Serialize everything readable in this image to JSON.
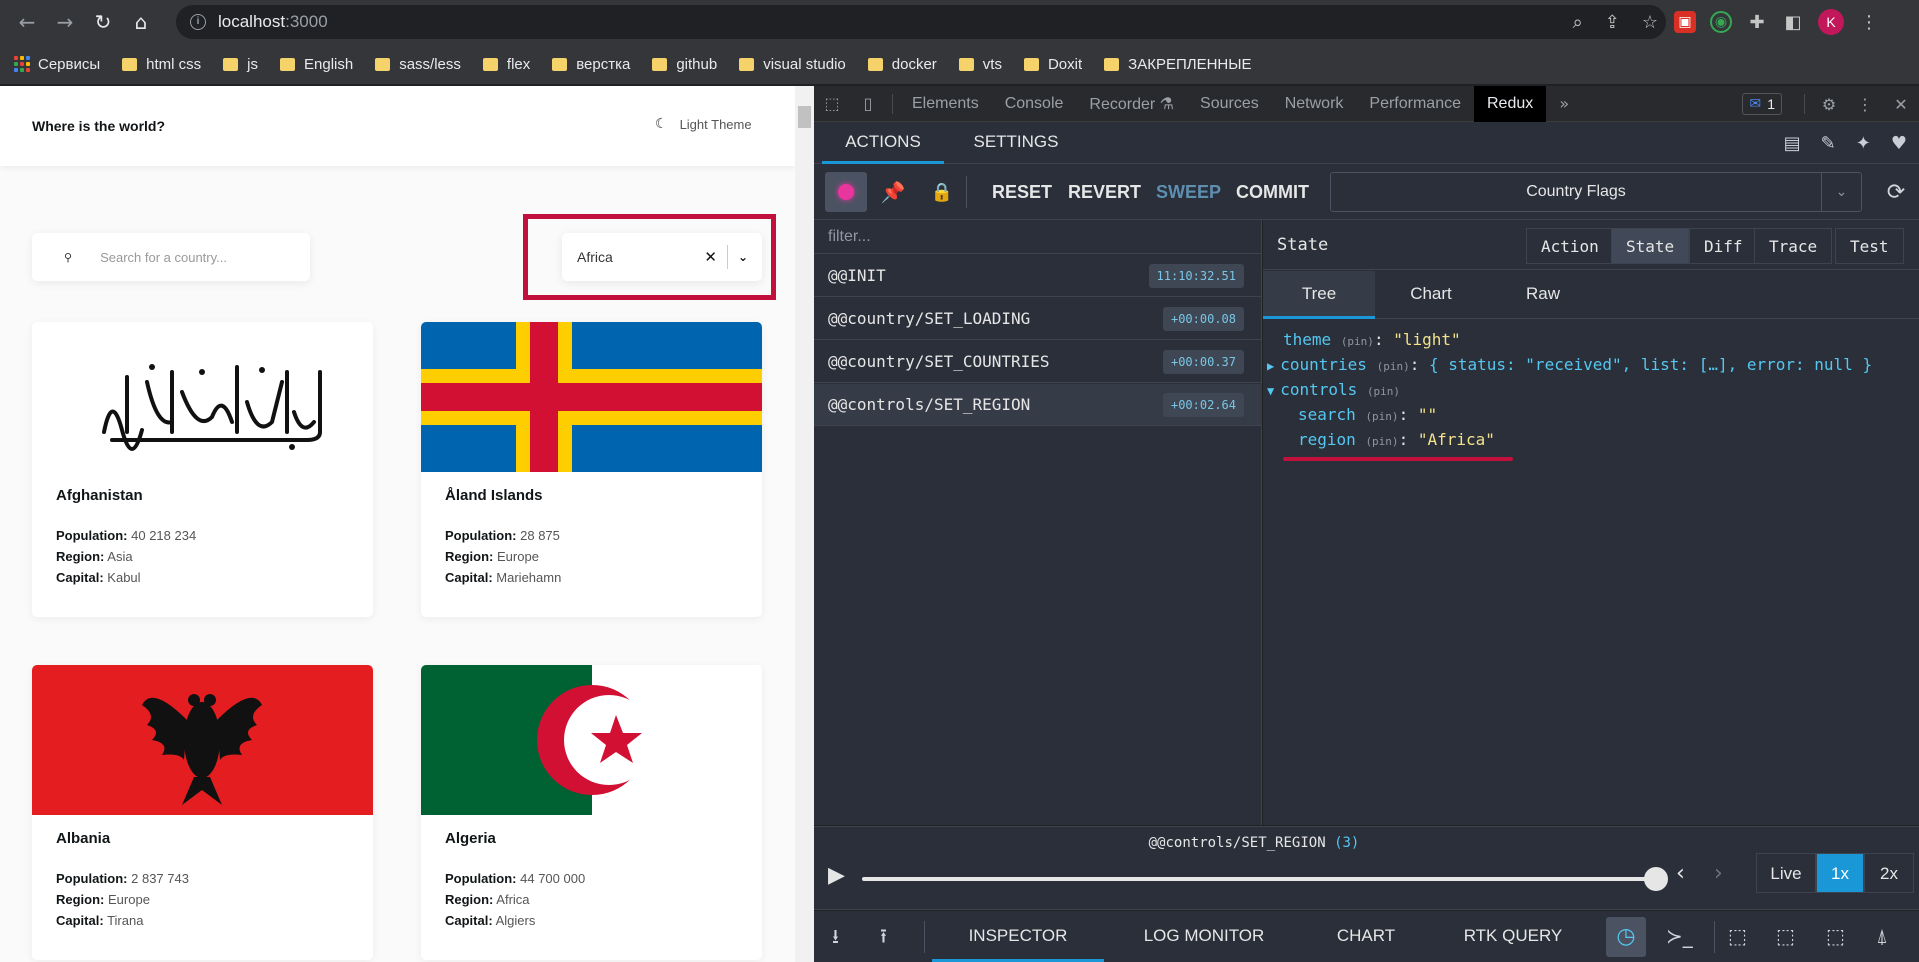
{
  "browser": {
    "url_host": "localhost",
    "url_port": ":3000",
    "bookmarks": [
      "Сервисы",
      "html css",
      "js",
      "English",
      "sass/less",
      "flex",
      "верстка",
      "github",
      "visual studio",
      "docker",
      "vts",
      "Doxit",
      "ЗАКРЕПЛЕННЫЕ"
    ],
    "profile_initial": "K"
  },
  "app": {
    "title": "Where is the world?",
    "theme_label": "Light Theme",
    "search_placeholder": "Search for a country...",
    "region_value": "Africa",
    "labels": {
      "population": "Population:",
      "region": "Region:",
      "capital": "Capital:"
    },
    "countries": [
      {
        "name": "Afghanistan",
        "population": "40 218 234",
        "region": "Asia",
        "capital": "Kabul"
      },
      {
        "name": "Åland Islands",
        "population": "28 875",
        "region": "Europe",
        "capital": "Mariehamn"
      },
      {
        "name": "Albania",
        "population": "2 837 743",
        "region": "Europe",
        "capital": "Tirana"
      },
      {
        "name": "Algeria",
        "population": "44 700 000",
        "region": "Africa",
        "capital": "Algiers"
      }
    ]
  },
  "devtools": {
    "tabs": [
      "Elements",
      "Console",
      "Recorder",
      "Sources",
      "Network",
      "Performance",
      "Redux"
    ],
    "issues_count": "1",
    "redux": {
      "top_tabs": [
        "ACTIONS",
        "SETTINGS"
      ],
      "toolbar": {
        "reset": "RESET",
        "revert": "REVERT",
        "sweep": "SWEEP",
        "commit": "COMMIT",
        "instance": "Country Flags"
      },
      "filter_placeholder": "filter...",
      "actions": [
        {
          "name": "@@INIT",
          "time": "11:10:32.51"
        },
        {
          "name": "@@country/SET_LOADING",
          "time": "+00:00.08"
        },
        {
          "name": "@@country/SET_COUNTRIES",
          "time": "+00:00.37"
        },
        {
          "name": "@@controls/SET_REGION",
          "time": "+00:02.64"
        }
      ],
      "state_label": "State",
      "monitor_tabs": [
        "Action",
        "State",
        "Diff",
        "Trace",
        "Test"
      ],
      "sub_tabs": [
        "Tree",
        "Chart",
        "Raw"
      ],
      "tree": {
        "pin": "(pin)",
        "theme_key": "theme",
        "theme_val": "\"light\"",
        "countries_key": "countries",
        "countries_val": "{ status: \"received\", list: […], error: null }",
        "controls_key": "controls",
        "search_key": "search",
        "search_val": "\"\"",
        "region_key": "region",
        "region_val": "\"Africa\""
      },
      "slider_label": "@@controls/SET_REGION",
      "slider_count": "(3)",
      "speeds": [
        "Live",
        "1x",
        "2x"
      ],
      "bottom_tabs": [
        "INSPECTOR",
        "LOG MONITOR",
        "CHART",
        "RTK QUERY"
      ]
    }
  },
  "colors": {
    "accent": "#1a97d6",
    "highlight": "#c2103d",
    "record": "#e8369e"
  }
}
